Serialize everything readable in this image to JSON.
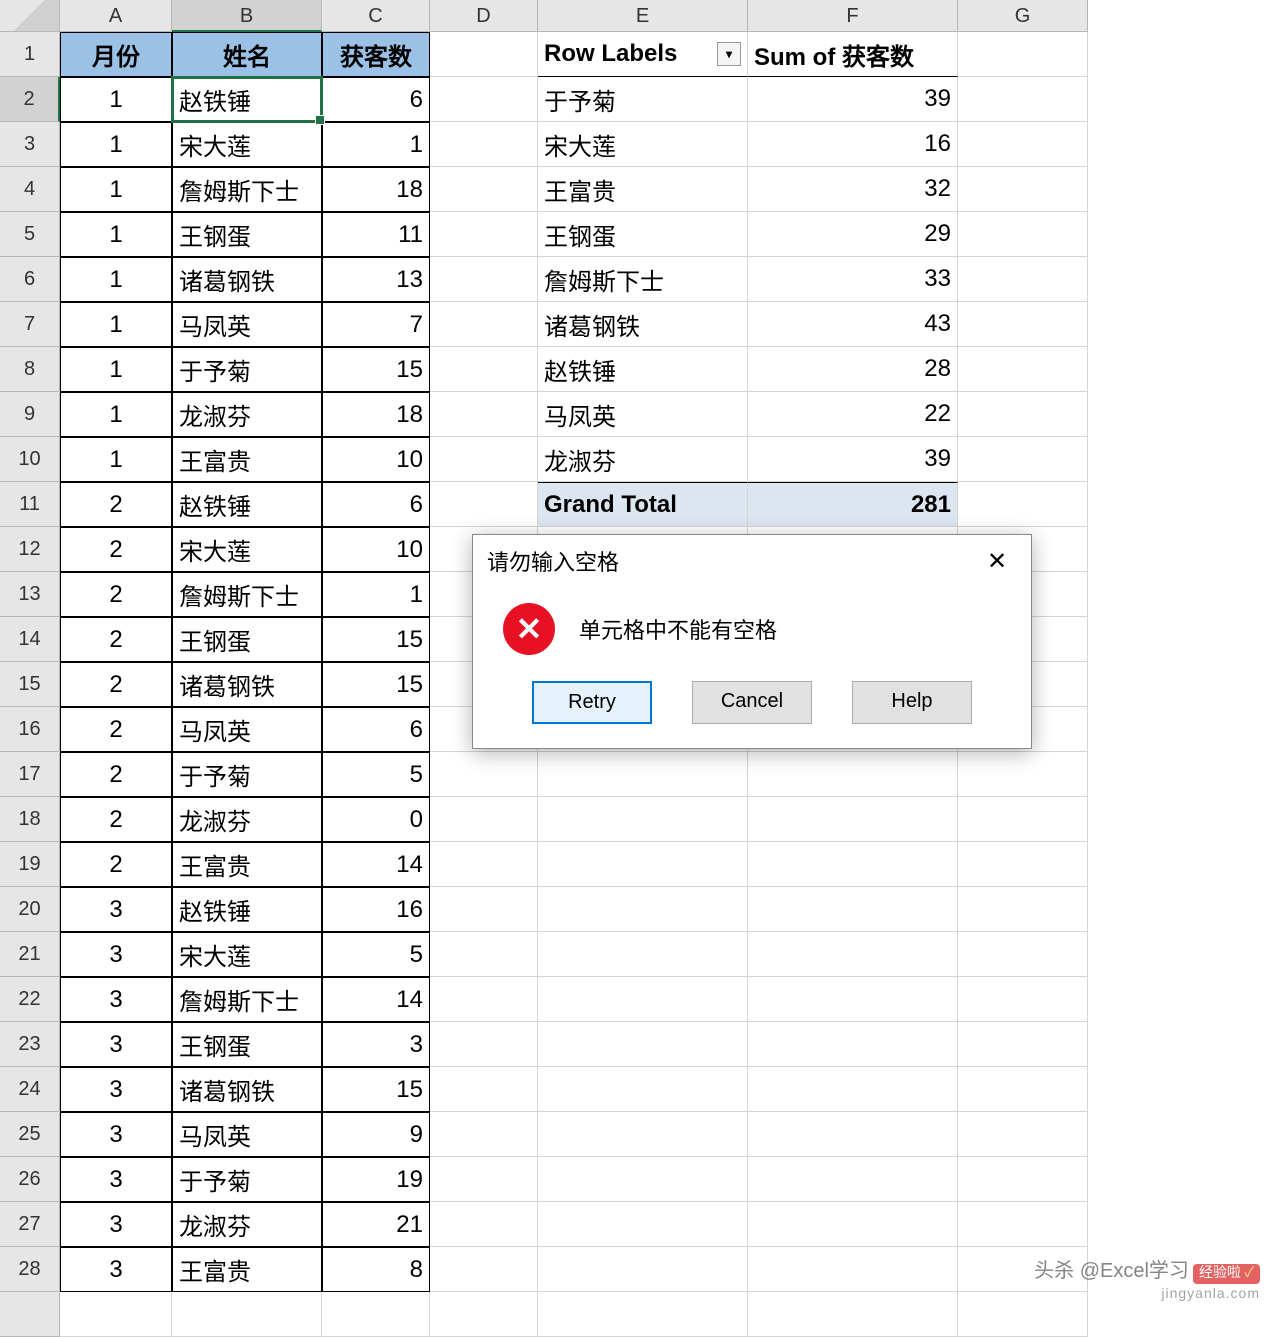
{
  "columns": [
    "A",
    "B",
    "C",
    "D",
    "E",
    "F",
    "G"
  ],
  "selected_col_index": 1,
  "selected_row_index": 1,
  "row_count": 29,
  "data_headers": {
    "A": "月份",
    "B": "姓名",
    "C": "获客数"
  },
  "data_rows": [
    {
      "a": "1",
      "b": "赵铁锤",
      "c": "6"
    },
    {
      "a": "1",
      "b": "宋大莲",
      "c": "1"
    },
    {
      "a": "1",
      "b": "詹姆斯下士",
      "c": "18"
    },
    {
      "a": "1",
      "b": "王钢蛋",
      "c": "11"
    },
    {
      "a": "1",
      "b": "诸葛钢铁",
      "c": "13"
    },
    {
      "a": "1",
      "b": "马凤英",
      "c": "7"
    },
    {
      "a": "1",
      "b": "于予菊",
      "c": "15"
    },
    {
      "a": "1",
      "b": "龙淑芬",
      "c": "18"
    },
    {
      "a": "1",
      "b": "王富贵",
      "c": "10"
    },
    {
      "a": "2",
      "b": "赵铁锤",
      "c": "6"
    },
    {
      "a": "2",
      "b": "宋大莲",
      "c": "10"
    },
    {
      "a": "2",
      "b": "詹姆斯下士",
      "c": "1"
    },
    {
      "a": "2",
      "b": "王钢蛋",
      "c": "15"
    },
    {
      "a": "2",
      "b": "诸葛钢铁",
      "c": "15"
    },
    {
      "a": "2",
      "b": "马凤英",
      "c": "6"
    },
    {
      "a": "2",
      "b": "于予菊",
      "c": "5"
    },
    {
      "a": "2",
      "b": "龙淑芬",
      "c": "0"
    },
    {
      "a": "2",
      "b": "王富贵",
      "c": "14"
    },
    {
      "a": "3",
      "b": "赵铁锤",
      "c": "16"
    },
    {
      "a": "3",
      "b": "宋大莲",
      "c": "5"
    },
    {
      "a": "3",
      "b": "詹姆斯下士",
      "c": "14"
    },
    {
      "a": "3",
      "b": "王钢蛋",
      "c": "3"
    },
    {
      "a": "3",
      "b": "诸葛钢铁",
      "c": "15"
    },
    {
      "a": "3",
      "b": "马凤英",
      "c": "9"
    },
    {
      "a": "3",
      "b": "于予菊",
      "c": "19"
    },
    {
      "a": "3",
      "b": "龙淑芬",
      "c": "21"
    },
    {
      "a": "3",
      "b": "王富贵",
      "c": "8"
    }
  ],
  "pivot": {
    "row_label_header": "Row Labels",
    "value_header": "Sum of 获客数",
    "rows": [
      {
        "label": "于予菊",
        "value": "39"
      },
      {
        "label": "宋大莲",
        "value": "16"
      },
      {
        "label": "王富贵",
        "value": "32"
      },
      {
        "label": "王钢蛋",
        "value": "29"
      },
      {
        "label": "詹姆斯下士",
        "value": "33"
      },
      {
        "label": "诸葛钢铁",
        "value": "43"
      },
      {
        "label": "赵铁锤",
        "value": "28"
      },
      {
        "label": "马凤英",
        "value": "22"
      },
      {
        "label": "龙淑芬",
        "value": "39"
      }
    ],
    "grand_total_label": "Grand Total",
    "grand_total_value": "281"
  },
  "dialog": {
    "title": "请勿输入空格",
    "message": "单元格中不能有空格",
    "buttons": {
      "retry": "Retry",
      "cancel": "Cancel",
      "help": "Help"
    }
  },
  "watermark": {
    "line1_prefix": "头杀 @Excel学习",
    "badge": "经验啦",
    "check": "✓",
    "site": "jingyanla.com"
  }
}
